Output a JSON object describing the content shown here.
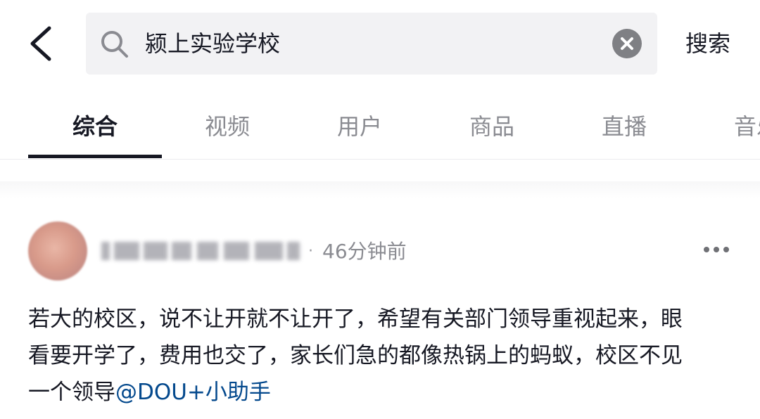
{
  "header": {
    "search_query": "颍上实验学校",
    "search_button": "搜索"
  },
  "tabs": [
    {
      "label": "综合",
      "active": true
    },
    {
      "label": "视频",
      "active": false
    },
    {
      "label": "用户",
      "active": false
    },
    {
      "label": "商品",
      "active": false
    },
    {
      "label": "直播",
      "active": false
    },
    {
      "label": "音乐",
      "active": false
    }
  ],
  "post": {
    "time": "46分钟前",
    "separator": "·",
    "text_lines": [
      "若大的校区，说不让开就不让开了，希望有关部门领导重视起来，眼",
      "看要开学了，费用也交了，家长们急的都像热锅上的蚂蚁，校区不见",
      "一个领导"
    ],
    "mention": "@DOU+小助手"
  },
  "icons": {
    "back": "chevron-left-icon",
    "search": "search-icon",
    "clear": "close-circle-icon",
    "more": "more-dots-icon"
  },
  "colors": {
    "text_primary": "#161823",
    "text_secondary": "#8a8b91",
    "mention": "#04498d",
    "search_bg": "#f2f2f4"
  }
}
